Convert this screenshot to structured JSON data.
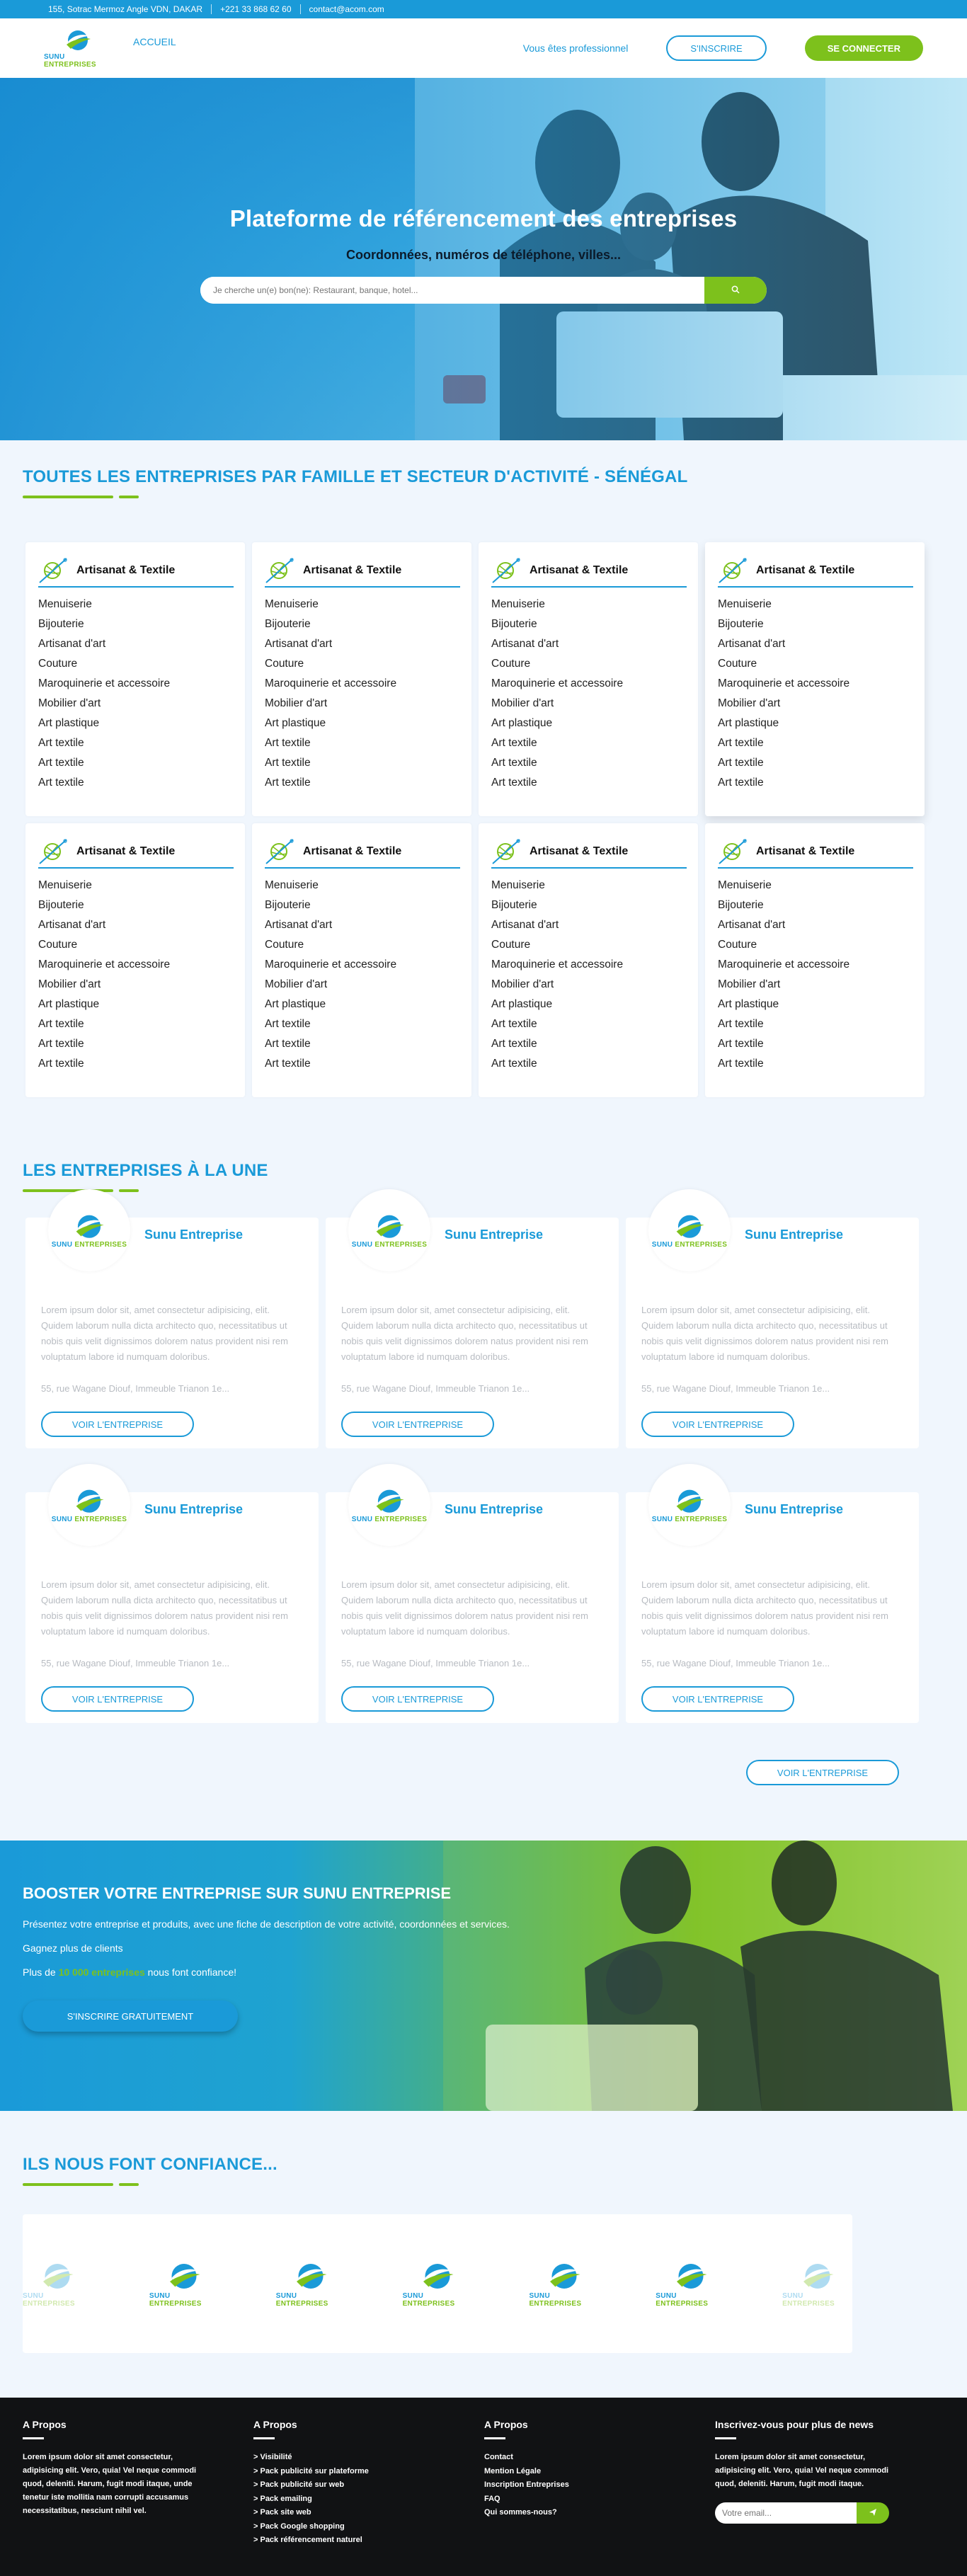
{
  "topbar": {
    "address": "155, Sotrac Mermoz Angle VDN, DAKAR",
    "phone": "+221 33 868 62 60",
    "email": "contact@acom.com"
  },
  "brand": {
    "logo_text_1": "SUNU",
    "logo_text_2": "ENTREPRISES"
  },
  "nav": {
    "home": "ACCUEIL",
    "pro": "Vous êtes professionnel",
    "signup": "S'INSCRIRE",
    "login": "SE CONNECTER"
  },
  "hero": {
    "title": "Plateforme de référencement des entreprises",
    "subtitle": "Coordonnées, numéros de téléphone, villes...",
    "search_placeholder": "Je cherche un(e) bon(ne): Restaurant, banque, hotel..."
  },
  "categories": {
    "title": "TOUTES LES ENTREPRISES PAR FAMILLE ET SECTEUR D'ACTIVITÉ - SÉNÉGAL",
    "cards": [
      {
        "title": "Artisanat & Textile",
        "items": [
          "Menuiserie",
          "Bijouterie",
          "Artisanat d'art",
          "Couture",
          "Maroquinerie et accessoire",
          "Mobilier d'art",
          "Art plastique",
          "Art textile",
          "Art textile",
          "Art textile"
        ]
      },
      {
        "title": "Artisanat & Textile",
        "items": [
          "Menuiserie",
          "Bijouterie",
          "Artisanat d'art",
          "Couture",
          "Maroquinerie et accessoire",
          "Mobilier d'art",
          "Art plastique",
          "Art textile",
          "Art textile",
          "Art textile"
        ]
      },
      {
        "title": "Artisanat & Textile",
        "items": [
          "Menuiserie",
          "Bijouterie",
          "Artisanat d'art",
          "Couture",
          "Maroquinerie et accessoire",
          "Mobilier d'art",
          "Art plastique",
          "Art textile",
          "Art textile",
          "Art textile"
        ]
      },
      {
        "title": "Artisanat & Textile",
        "items": [
          "Menuiserie",
          "Bijouterie",
          "Artisanat d'art",
          "Couture",
          "Maroquinerie et accessoire",
          "Mobilier d'art",
          "Art plastique",
          "Art textile",
          "Art textile",
          "Art textile"
        ]
      },
      {
        "title": "Artisanat & Textile",
        "items": [
          "Menuiserie",
          "Bijouterie",
          "Artisanat d'art",
          "Couture",
          "Maroquinerie et accessoire",
          "Mobilier d'art",
          "Art plastique",
          "Art textile",
          "Art textile",
          "Art textile"
        ]
      },
      {
        "title": "Artisanat & Textile",
        "items": [
          "Menuiserie",
          "Bijouterie",
          "Artisanat d'art",
          "Couture",
          "Maroquinerie et accessoire",
          "Mobilier d'art",
          "Art plastique",
          "Art textile",
          "Art textile",
          "Art textile"
        ]
      },
      {
        "title": "Artisanat & Textile",
        "items": [
          "Menuiserie",
          "Bijouterie",
          "Artisanat d'art",
          "Couture",
          "Maroquinerie et accessoire",
          "Mobilier d'art",
          "Art plastique",
          "Art textile",
          "Art textile",
          "Art textile"
        ]
      },
      {
        "title": "Artisanat & Textile",
        "items": [
          "Menuiserie",
          "Bijouterie",
          "Artisanat d'art",
          "Couture",
          "Maroquinerie et accessoire",
          "Mobilier d'art",
          "Art plastique",
          "Art textile",
          "Art textile",
          "Art textile"
        ]
      }
    ]
  },
  "featured": {
    "title": "LES ENTREPRISES À LA UNE",
    "more_button": "VOIR L'ENTREPRISE",
    "cards": [
      {
        "name": "Sunu Entreprise",
        "desc": "Lorem ipsum dolor sit, amet consectetur adipisicing, elit. Quidem laborum nulla dicta architecto quo, necessitatibus ut nobis quis velit dignissimos dolorem natus provident nisi rem voluptatum labore id numquam doloribus.",
        "address": "55, rue Wagane Diouf, Immeuble Trianon 1e...",
        "button": "VOIR L'ENTREPRISE"
      },
      {
        "name": "Sunu Entreprise",
        "desc": "Lorem ipsum dolor sit, amet consectetur adipisicing, elit. Quidem laborum nulla dicta architecto quo, necessitatibus ut nobis quis velit dignissimos dolorem natus provident nisi rem voluptatum labore id numquam doloribus.",
        "address": "55, rue Wagane Diouf, Immeuble Trianon 1e...",
        "button": "VOIR L'ENTREPRISE"
      },
      {
        "name": "Sunu Entreprise",
        "desc": "Lorem ipsum dolor sit, amet consectetur adipisicing, elit. Quidem laborum nulla dicta architecto quo, necessitatibus ut nobis quis velit dignissimos dolorem natus provident nisi rem voluptatum labore id numquam doloribus.",
        "address": "55, rue Wagane Diouf, Immeuble Trianon 1e...",
        "button": "VOIR L'ENTREPRISE"
      },
      {
        "name": "Sunu Entreprise",
        "desc": "Lorem ipsum dolor sit, amet consectetur adipisicing, elit. Quidem laborum nulla dicta architecto quo, necessitatibus ut nobis quis velit dignissimos dolorem natus provident nisi rem voluptatum labore id numquam doloribus.",
        "address": "55, rue Wagane Diouf, Immeuble Trianon 1e...",
        "button": "VOIR L'ENTREPRISE"
      },
      {
        "name": "Sunu Entreprise",
        "desc": "Lorem ipsum dolor sit, amet consectetur adipisicing, elit. Quidem laborum nulla dicta architecto quo, necessitatibus ut nobis quis velit dignissimos dolorem natus provident nisi rem voluptatum labore id numquam doloribus.",
        "address": "55, rue Wagane Diouf, Immeuble Trianon 1e...",
        "button": "VOIR L'ENTREPRISE"
      },
      {
        "name": "Sunu Entreprise",
        "desc": "Lorem ipsum dolor sit, amet consectetur adipisicing, elit. Quidem laborum nulla dicta architecto quo, necessitatibus ut nobis quis velit dignissimos dolorem natus provident nisi rem voluptatum labore id numquam doloribus.",
        "address": "55, rue Wagane Diouf, Immeuble Trianon 1e...",
        "button": "VOIR L'ENTREPRISE"
      }
    ]
  },
  "booster": {
    "title": "BOOSTER VOTRE ENTREPRISE SUR SUNU ENTREPRISE",
    "line1": "Présentez votre entreprise et produits, avec une fiche de description de votre activité, coordonnées et services.",
    "line2": "Gagnez plus de clients",
    "line3_pre": "Plus de ",
    "line3_highlight": "10 000 entreprises",
    "line3_post": " nous font confiance!",
    "button": "S'INSCRIRE GRATUITEMENT"
  },
  "partners": {
    "title": "ILS NOUS FONT CONFIANCE..."
  },
  "footer": {
    "col1": {
      "title": "A Propos",
      "text": "Lorem ipsum dolor sit amet consectetur, adipisicing elit. Vero, quia! Vel neque commodi quod, deleniti. Harum, fugit modi itaque, unde tenetur iste mollitia nam corrupti accusamus necessitatibus, nesciunt nihil vel."
    },
    "col2": {
      "title": "A Propos",
      "links": [
        "> Visibilité",
        "> Pack publicité sur plateforme",
        "> Pack publicité sur web",
        "> Pack emailing",
        "> Pack site web",
        "> Pack Google shopping",
        "> Pack référencement naturel"
      ]
    },
    "col3": {
      "title": "A Propos",
      "links": [
        "Contact",
        "Mention Légale",
        "Inscription Entreprises",
        "FAQ",
        "Qui sommes-nous?"
      ]
    },
    "col4": {
      "title": "Inscrivez-vous pour plus de news",
      "text": "Lorem ipsum dolor sit amet consectetur, adipisicing elit. Vero, quia! Vel neque commodi quod, deleniti. Harum, fugit modi itaque.",
      "placeholder": "Votre email..."
    }
  },
  "colors": {
    "primary": "#1a9ad8",
    "accent": "#7dc11c",
    "footer_bg": "#111214"
  }
}
